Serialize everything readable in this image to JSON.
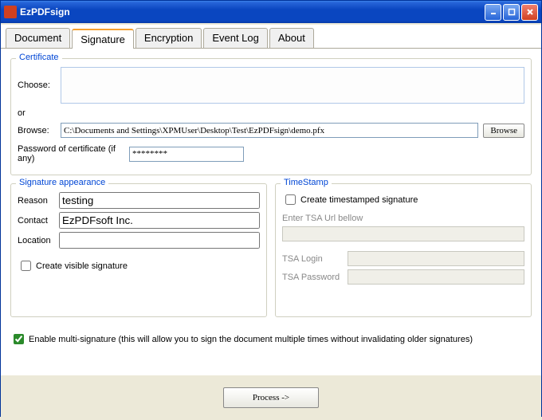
{
  "window": {
    "title": "EzPDFsign"
  },
  "tabs": {
    "t0": "Document",
    "t1": "Signature",
    "t2": "Encryption",
    "t3": "Event Log",
    "t4": "About"
  },
  "cert": {
    "legend": "Certificate",
    "choose_label": "Choose:",
    "or": "or",
    "browse_label": "Browse:",
    "browse_value": "C:\\Documents and Settings\\XPMUser\\Desktop\\Test\\EzPDFsign\\demo.pfx",
    "browse_btn": "Browse",
    "pwd_label": "Password of certificate (if any)",
    "pwd_value": "********"
  },
  "sig": {
    "legend": "Signature appearance",
    "reason_label": "Reason",
    "reason_value": "testing",
    "contact_label": "Contact",
    "contact_value": "EzPDFsoft Inc.",
    "location_label": "Location",
    "location_value": "",
    "visible_label": "Create visible signature"
  },
  "ts": {
    "legend": "TimeStamp",
    "create_label": "Create timestamped signature",
    "url_hint": "Enter TSA Url bellow",
    "login_label": "TSA Login",
    "pwd_label": "TSA Password"
  },
  "multi": {
    "label": "Enable multi-signature (this will allow you to sign the document multiple times without invalidating older signatures)"
  },
  "footer": {
    "process": "Process ->"
  }
}
